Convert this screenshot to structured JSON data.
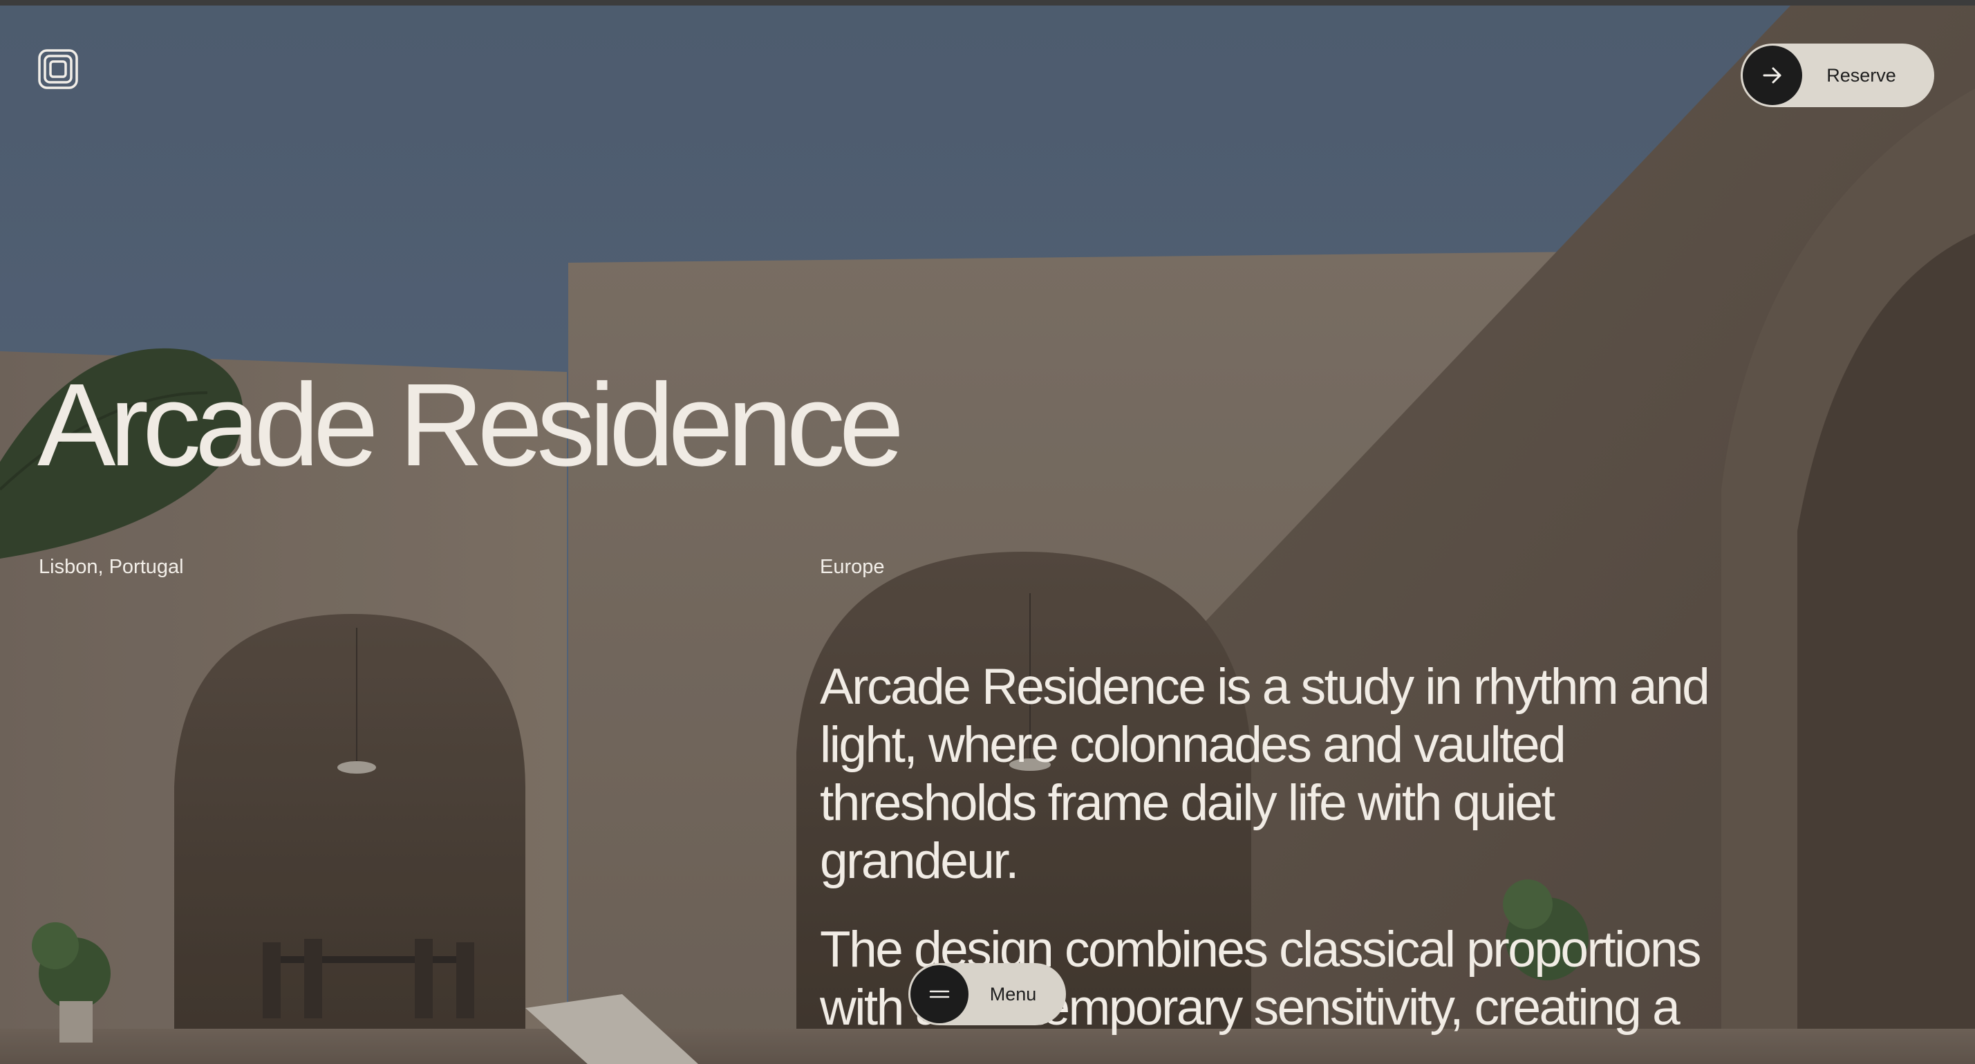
{
  "brand": {
    "logo_icon": "spiral-square-logo"
  },
  "header": {
    "reserve_label": "Reserve",
    "reserve_icon": "arrow-right-icon"
  },
  "hero": {
    "title": "Arcade Residence",
    "location": "Lisbon, Portugal",
    "region": "Europe",
    "paragraphs": [
      "Arcade Residence is a study in rhythm and light, where colonnades and vaulted thresholds frame daily life with quiet grandeur.",
      "The design combines classical proportions with a contemporary sensitivity, creating a"
    ]
  },
  "nav": {
    "menu_label": "Menu",
    "menu_icon": "hamburger-icon"
  },
  "colors": {
    "sky": "#5a6e84",
    "wall": "#8f8273",
    "text": "#f0ebe4",
    "pill": "#dcd7ce",
    "dark": "#1c1c1c"
  }
}
